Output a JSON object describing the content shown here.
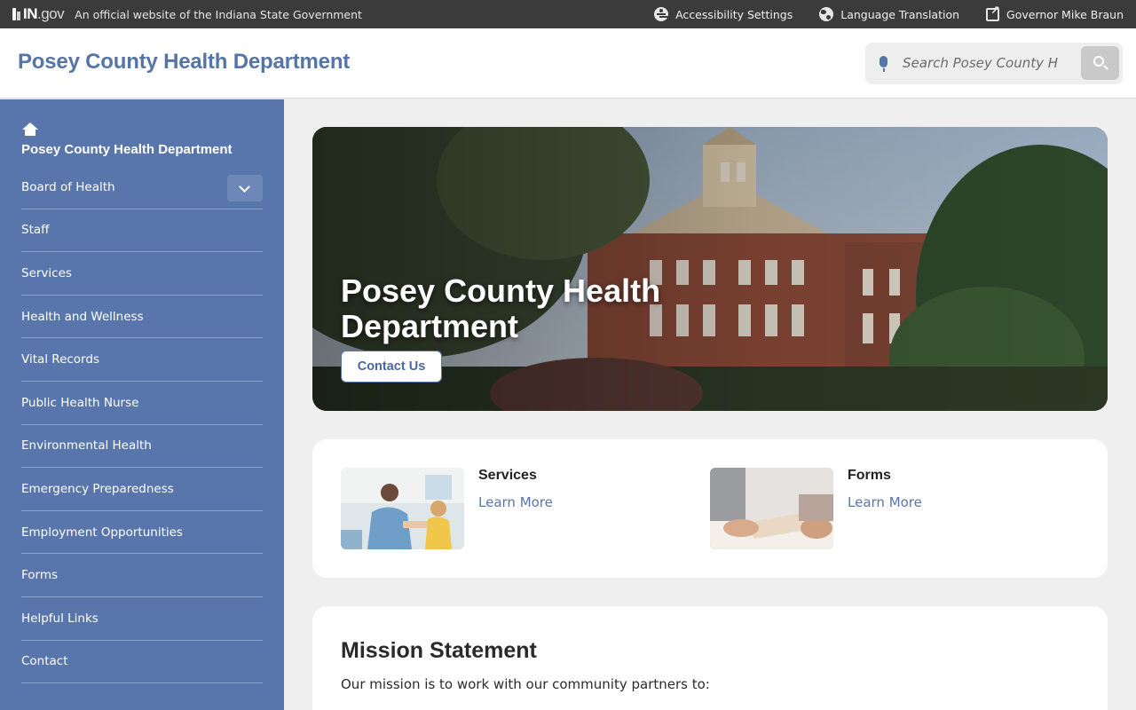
{
  "topbar": {
    "logo_in": "IN",
    "logo_gov": ".gov",
    "official_text": "An official website of the Indiana State Government",
    "links": [
      {
        "label": "Accessibility Settings",
        "icon": "accessibility-icon"
      },
      {
        "label": "Language Translation",
        "icon": "globe-icon"
      },
      {
        "label": "Governor Mike Braun",
        "icon": "external-link-icon"
      }
    ]
  },
  "header": {
    "title": "Posey County Health Department",
    "search_placeholder": "Search Posey County H"
  },
  "sidebar": {
    "home_label": "Posey County Health Department",
    "items": [
      {
        "label": "Board of Health",
        "has_toggle": true
      },
      {
        "label": "Staff"
      },
      {
        "label": "Services"
      },
      {
        "label": "Health and Wellness"
      },
      {
        "label": "Vital Records"
      },
      {
        "label": "Public Health Nurse"
      },
      {
        "label": "Environmental Health"
      },
      {
        "label": "Emergency Preparedness"
      },
      {
        "label": "Employment Opportunities"
      },
      {
        "label": "Forms"
      },
      {
        "label": "Helpful Links"
      },
      {
        "label": "Contact"
      }
    ]
  },
  "hero": {
    "title": "Posey County Health Department",
    "button": "Contact Us"
  },
  "cards": [
    {
      "title": "Services",
      "link": "Learn More"
    },
    {
      "title": "Forms",
      "link": "Learn More"
    }
  ],
  "mission": {
    "title": "Mission Statement",
    "text": "Our mission is to work with our community partners to:"
  },
  "colors": {
    "brand_blue": "#5876ab",
    "topbar": "#3b3b3b",
    "page_bg": "#efefef"
  }
}
